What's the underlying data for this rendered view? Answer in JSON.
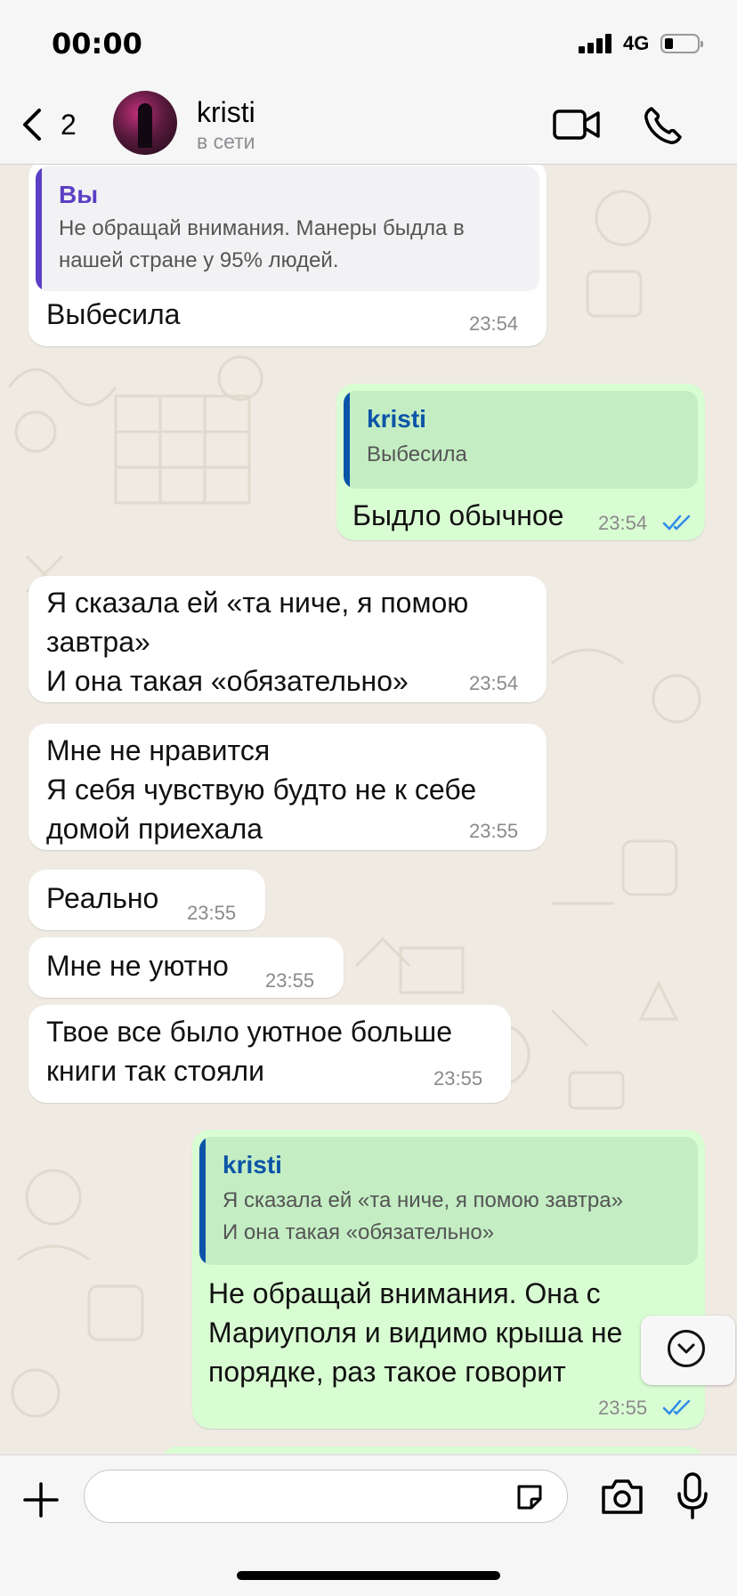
{
  "status_bar": {
    "time": "00:00",
    "network": "4G"
  },
  "header": {
    "back_count": "2",
    "contact_name": "kristi",
    "contact_status": "в сети",
    "icons": [
      "chevron-left-icon",
      "video-camera-icon",
      "phone-icon"
    ]
  },
  "messages": [
    {
      "direction": "in",
      "quote": {
        "author": "Вы",
        "text_lines": [
          "Не обращай внимания. Манеры быдла в",
          "нашей стране у 95% людей."
        ]
      },
      "lines": [
        "Выбесила"
      ],
      "time": "23:54"
    },
    {
      "direction": "out",
      "quote": {
        "author": "kristi",
        "text_lines": [
          "Выбесила"
        ]
      },
      "lines": [
        "Быдло обычное"
      ],
      "time": "23:54",
      "read": true
    },
    {
      "direction": "in",
      "lines": [
        "Я сказала ей «та ниче, я помою",
        "завтра»",
        "И она такая «обязательно»"
      ],
      "time": "23:54"
    },
    {
      "direction": "in",
      "lines": [
        "Мне не нравится",
        "Я себя чувствую будто не к себе",
        "домой приехала"
      ],
      "time": "23:55"
    },
    {
      "direction": "in",
      "lines": [
        "Реально"
      ],
      "time": "23:55"
    },
    {
      "direction": "in",
      "lines": [
        "Мне не уютно"
      ],
      "time": "23:55"
    },
    {
      "direction": "in",
      "lines": [
        "Твое все было уютное больше",
        "книги так стояли"
      ],
      "time": "23:55"
    },
    {
      "direction": "out",
      "quote": {
        "author": "kristi",
        "text_lines": [
          "Я сказала ей «та ниче, я помою завтра»",
          "И она такая «обязательно»"
        ]
      },
      "lines": [
        "Не обращай внимания. Она с",
        "Мариуполя и видимо крыша не",
        "порядке, раз такое говорит"
      ],
      "time": "23:55",
      "read": true
    }
  ],
  "composer": {
    "value": "",
    "placeholder": ""
  },
  "colors": {
    "incoming_bubble": "#ffffff",
    "outgoing_bubble": "#d9fdd3",
    "quote_you": "#5b3fc4",
    "quote_contact": "#0b54a8",
    "read_ticks": "#2f8ce8",
    "chat_background": "#efeae2"
  }
}
